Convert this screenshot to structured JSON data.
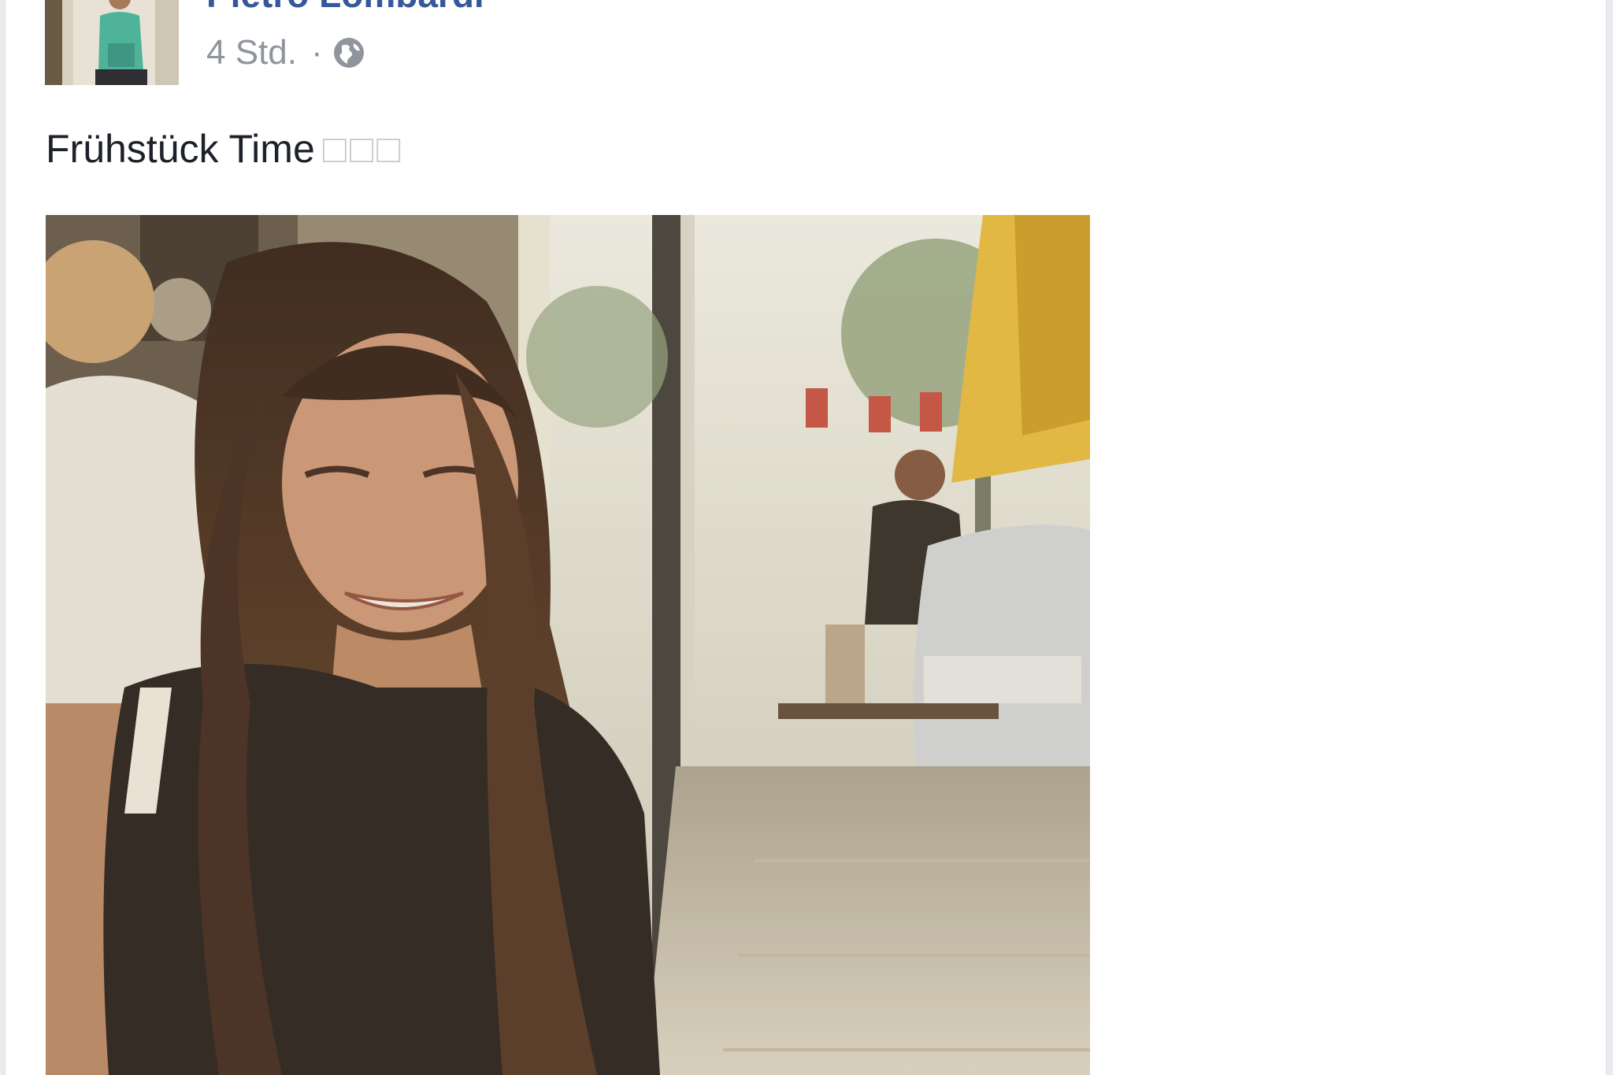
{
  "post": {
    "author": "Pietro Lombardi",
    "timestamp": "4 Std.",
    "separator": "·",
    "privacy_icon": "globe-icon",
    "text": "Frühstück Time",
    "emoji_placeholder": "□□□"
  },
  "colors": {
    "author_link": "#365899",
    "meta_text": "#90949c",
    "body_text": "#1d2129"
  }
}
